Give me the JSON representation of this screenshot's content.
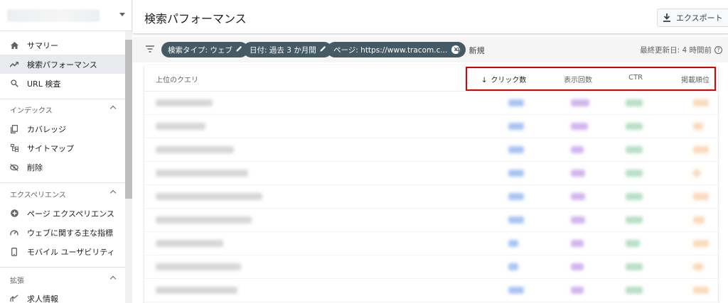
{
  "sidebar": {
    "items": [
      {
        "label": "サマリー",
        "icon": "home-icon"
      },
      {
        "label": "検索パフォーマンス",
        "icon": "trending-up-icon",
        "active": true
      },
      {
        "label": "URL 検査",
        "icon": "search-icon"
      }
    ],
    "sections": [
      {
        "title": "インデックス",
        "items": [
          {
            "label": "カバレッジ",
            "icon": "coverage-icon"
          },
          {
            "label": "サイトマップ",
            "icon": "sitemap-icon"
          },
          {
            "label": "削除",
            "icon": "visibility-off-icon"
          }
        ]
      },
      {
        "title": "エクスペリエンス",
        "items": [
          {
            "label": "ページ エクスペリエンス",
            "icon": "plus-circle-icon"
          },
          {
            "label": "ウェブに関する主な指標",
            "icon": "speed-icon"
          },
          {
            "label": "モバイル ユーザビリティ",
            "icon": "phone-icon"
          }
        ]
      },
      {
        "title": "拡張",
        "items": [
          {
            "label": "求人情報",
            "icon": "job-icon"
          }
        ]
      }
    ]
  },
  "header": {
    "title": "検索パフォーマンス",
    "export_label": "エクスポート"
  },
  "filters": {
    "chips": [
      {
        "label": "検索タイプ: ウェブ",
        "icon": "edit-icon"
      },
      {
        "label": "日付: 過去 3 か月間",
        "icon": "edit-icon"
      },
      {
        "label": "ページ: https://www.tracom.c...",
        "icon": "close-icon"
      }
    ],
    "new_label": "新規",
    "updated_label": "最終更新日: 4 時間前"
  },
  "table": {
    "columns": {
      "query": "上位のクエリ",
      "clicks": "クリック数",
      "impressions": "表示回数",
      "ctr": "CTR",
      "position": "掲載順位"
    },
    "sort_column": "clicks",
    "sort_direction": "desc"
  },
  "colors": {
    "chip_bg": "#455a64",
    "highlight_border": "#e00000",
    "clicks_series": "#4285f4",
    "impressions_series": "#9c27b0",
    "ctr_series": "#34a853",
    "position_series": "#fb8c00"
  }
}
